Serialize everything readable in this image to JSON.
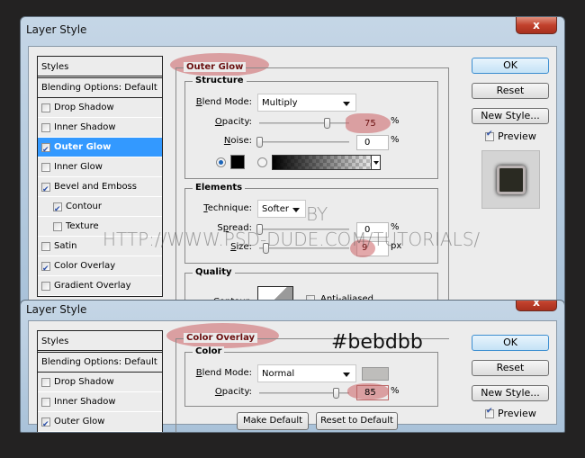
{
  "dialog_top": {
    "title": "Layer Style",
    "close_label": "x",
    "styles_header": "Styles",
    "blending_options": "Blending Options: Default",
    "style_items": [
      {
        "label": "Drop Shadow",
        "checked": false,
        "selected": false,
        "sub": false
      },
      {
        "label": "Inner Shadow",
        "checked": false,
        "selected": false,
        "sub": false
      },
      {
        "label": "Outer Glow",
        "checked": true,
        "selected": true,
        "sub": false
      },
      {
        "label": "Inner Glow",
        "checked": false,
        "selected": false,
        "sub": false
      },
      {
        "label": "Bevel and Emboss",
        "checked": true,
        "selected": false,
        "sub": false
      },
      {
        "label": "Contour",
        "checked": true,
        "selected": false,
        "sub": true
      },
      {
        "label": "Texture",
        "checked": false,
        "selected": false,
        "sub": true
      },
      {
        "label": "Satin",
        "checked": false,
        "selected": false,
        "sub": false
      },
      {
        "label": "Color Overlay",
        "checked": true,
        "selected": false,
        "sub": false
      },
      {
        "label": "Gradient Overlay",
        "checked": false,
        "selected": false,
        "sub": false
      }
    ],
    "panel_title": "Outer Glow",
    "structure": {
      "title": "Structure",
      "blend_mode_label": "Blend Mode:",
      "blend_mode_value": "Multiply",
      "opacity_label": "Opacity:",
      "opacity_value": "75",
      "opacity_unit": "%",
      "opacity_fraction": 0.75,
      "noise_label": "Noise:",
      "noise_value": "0",
      "noise_unit": "%",
      "noise_fraction": 0,
      "glow_color": "#000000",
      "color_mode": "solid"
    },
    "elements": {
      "title": "Elements",
      "technique_label": "Technique:",
      "technique_value": "Softer",
      "spread_label": "Spread:",
      "spread_value": "0",
      "spread_unit": "%",
      "size_label": "Size:",
      "size_value": "9",
      "size_unit": "px"
    },
    "quality": {
      "title": "Quality",
      "contour_label": "Contour:",
      "anti_aliased_label": "Anti-aliased",
      "anti_aliased_checked": false
    },
    "buttons": {
      "ok": "OK",
      "reset": "Reset",
      "new_style": "New Style...",
      "preview": "Preview",
      "preview_checked": true
    }
  },
  "dialog_bottom": {
    "title": "Layer Style",
    "close_label": "x",
    "styles_header": "Styles",
    "blending_options": "Blending Options: Default",
    "style_items": [
      {
        "label": "Drop Shadow",
        "checked": false
      },
      {
        "label": "Inner Shadow",
        "checked": false
      },
      {
        "label": "Outer Glow",
        "checked": true
      }
    ],
    "panel_title": "Color Overlay",
    "color": {
      "title": "Color",
      "blend_mode_label": "Blend Mode:",
      "blend_mode_value": "Normal",
      "swatch_color": "#bebdbb",
      "opacity_label": "Opacity:",
      "opacity_value": "85",
      "opacity_unit": "%",
      "opacity_fraction": 0.85
    },
    "make_default": "Make Default",
    "reset_to_default": "Reset to Default",
    "buttons": {
      "ok": "OK",
      "reset": "Reset",
      "new_style": "New Style...",
      "preview": "Preview",
      "preview_checked": true
    }
  },
  "annotations": {
    "hex_label": "#bebdbb",
    "watermark_by": "BY",
    "watermark_url": "HTTP://WWW.PSD-DUDE.COM/TUTORIALS/"
  }
}
